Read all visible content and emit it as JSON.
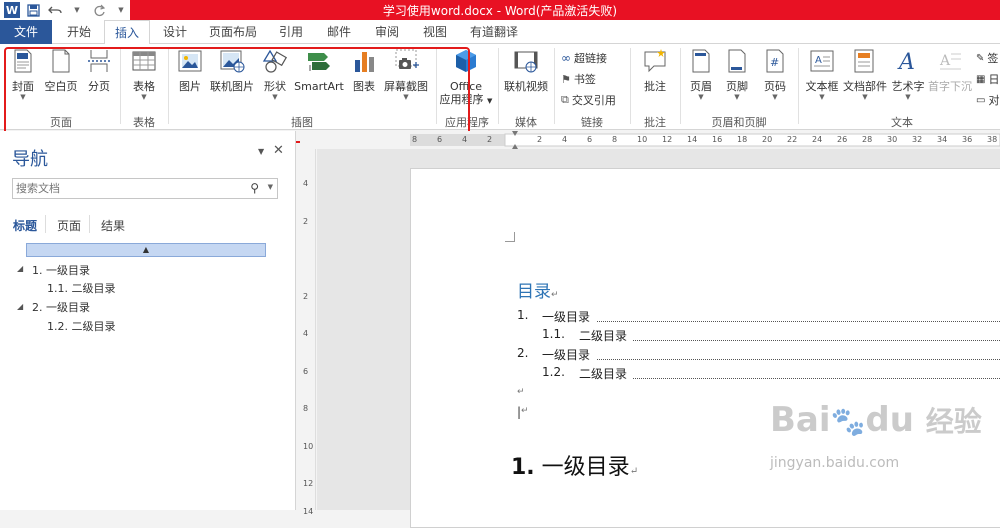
{
  "window": {
    "title": "学习使用word.docx -  Word(产品激活失败)",
    "accent_color": "#2b579a",
    "title_bar_color": "#e81123"
  },
  "quick_access": {
    "icons": [
      "word-logo-icon",
      "save-icon",
      "undo-icon",
      "redo-icon"
    ],
    "logo_letter": "W"
  },
  "tabs": {
    "file": "文件",
    "items": [
      "开始",
      "插入",
      "设计",
      "页面布局",
      "引用",
      "邮件",
      "审阅",
      "视图",
      "有道翻译"
    ],
    "active": "插入"
  },
  "ribbon": {
    "buttons": {
      "cover": "封面",
      "blank_page": "空白页",
      "page_break": "分页",
      "table": "表格",
      "picture": "图片",
      "online_picture": "联机图片",
      "shapes": "形状",
      "smartart": "SmartArt",
      "chart": "图表",
      "screenshot": "屏幕截图",
      "office_apps_line1": "Office",
      "office_apps_line2": "应用程序",
      "online_video": "联机视频",
      "hyperlink": "超链接",
      "bookmark": "书签",
      "cross_reference": "交叉引用",
      "comment": "批注",
      "header": "页眉",
      "footer": "页脚",
      "page_number": "页码",
      "textbox": "文本框",
      "quick_parts": "文档部件",
      "wordart": "艺术字",
      "drop_cap": "首字下沉",
      "sig_cut": "签",
      "date_cut": "日",
      "obj_cut": "对"
    },
    "groups": {
      "pages": "页面",
      "tables": "表格",
      "illustrations": "插图",
      "apps": "应用程序",
      "media": "媒体",
      "links": "链接",
      "comments": "批注",
      "header_footer": "页眉和页脚",
      "text": "文本"
    }
  },
  "ruler": {
    "h_ticks": [
      "8",
      "6",
      "4",
      "2",
      "",
      "2",
      "4",
      "6",
      "8",
      "10",
      "12",
      "14",
      "16",
      "18",
      "20",
      "22",
      "24",
      "26",
      "28",
      "30",
      "32",
      "34",
      "36",
      "38"
    ],
    "v_ticks": [
      "4",
      "2",
      "",
      "2",
      "4",
      "6",
      "8",
      "10",
      "12",
      "14"
    ]
  },
  "navigation": {
    "title": "导航",
    "search_placeholder": "搜索文档",
    "tabs": [
      "标题",
      "页面",
      "结果"
    ],
    "items": [
      {
        "label": "1. 一级目录",
        "level": 1,
        "expanded": true
      },
      {
        "label": "1.1. 二级目录",
        "level": 2
      },
      {
        "label": "2. 一级目录",
        "level": 1,
        "expanded": true
      },
      {
        "label": "1.2. 二级目录",
        "level": 2
      }
    ]
  },
  "document": {
    "toc_title": "目录",
    "toc_entries": [
      {
        "num": "1.",
        "text": "一级目录",
        "level": 1
      },
      {
        "num": "1.1.",
        "text": "二级目录",
        "level": 2
      },
      {
        "num": "2.",
        "text": "一级目录",
        "level": 1
      },
      {
        "num": "1.2.",
        "text": "二级目录",
        "level": 2
      }
    ],
    "paragraph_mark": "↵",
    "heading_num": "1.",
    "heading_text": "一级目录"
  },
  "watermark": {
    "brand": "Bai",
    "brand2": "du",
    "brand3": "经验",
    "url": "jingyan.baidu.com"
  }
}
